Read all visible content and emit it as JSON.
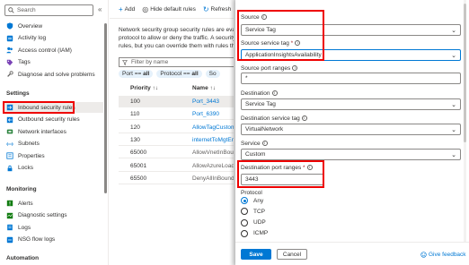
{
  "sidebar": {
    "search_placeholder": "Search",
    "collapse_glyph": "«",
    "items": [
      {
        "label": "Overview",
        "icon": "shield-icon",
        "color": "#0078d4"
      },
      {
        "label": "Activity log",
        "icon": "activity-log-icon",
        "color": "#0078d4"
      },
      {
        "label": "Access control (IAM)",
        "icon": "people-icon",
        "color": "#0078d4"
      },
      {
        "label": "Tags",
        "icon": "tag-icon",
        "color": "#7a43b6"
      },
      {
        "label": "Diagnose and solve problems",
        "icon": "wrench-icon",
        "color": "#605e5c"
      }
    ],
    "settings_header": "Settings",
    "settings_items": [
      {
        "label": "Inbound security rules",
        "icon": "inbound-icon",
        "color": "#0078d4"
      },
      {
        "label": "Outbound security rules",
        "icon": "outbound-icon",
        "color": "#0078d4"
      },
      {
        "label": "Network interfaces",
        "icon": "network-interface-icon",
        "color": "#2e8540"
      },
      {
        "label": "Subnets",
        "icon": "subnet-icon",
        "color": "#0078d4"
      },
      {
        "label": "Properties",
        "icon": "properties-icon",
        "color": "#0078d4"
      },
      {
        "label": "Locks",
        "icon": "lock-icon",
        "color": "#0078d4"
      }
    ],
    "monitoring_header": "Monitoring",
    "monitoring_items": [
      {
        "label": "Alerts",
        "icon": "alert-icon",
        "color": "#107c10"
      },
      {
        "label": "Diagnostic settings",
        "icon": "diagnostic-icon",
        "color": "#107c10"
      },
      {
        "label": "Logs",
        "icon": "logs-icon",
        "color": "#0078d4"
      },
      {
        "label": "NSG flow logs",
        "icon": "flow-logs-icon",
        "color": "#0078d4"
      }
    ],
    "automation_header": "Automation"
  },
  "toolbar": {
    "add": "Add",
    "hide_default": "Hide default rules",
    "refresh": "Refresh"
  },
  "main": {
    "desc_lines": [
      "Network security group security rules are evalua",
      "protocol to allow or deny the traffic. A security r",
      "rules, but you can override them with rules that l"
    ],
    "filter_placeholder": "Filter by name",
    "pills": [
      {
        "key": "Port == ",
        "val": "all"
      },
      {
        "key": "Protocol == ",
        "val": "all"
      },
      {
        "key": "So",
        "val": ""
      }
    ],
    "col_priority": "Priority ↑↓",
    "col_name": "Name ↑↓",
    "rows": [
      {
        "priority": "100",
        "name": "Port_3443",
        "link": true
      },
      {
        "priority": "110",
        "name": "Port_6390",
        "link": true
      },
      {
        "priority": "120",
        "name": "AllowTagCustom",
        "link": true
      },
      {
        "priority": "130",
        "name": "internetToMgtEn",
        "link": true
      },
      {
        "priority": "65000",
        "name": "AllowVnetInBoun",
        "link": false
      },
      {
        "priority": "65001",
        "name": "AllowAzureLoadB",
        "link": false
      },
      {
        "priority": "65500",
        "name": "DenyAllInBound",
        "link": false
      }
    ]
  },
  "panel": {
    "source_label": "Source",
    "source_value": "Service Tag",
    "source_tag_label": "Source service tag",
    "source_tag_value": "ApplicationInsightsAvailability",
    "source_ports_label": "Source port ranges",
    "source_ports_value": "*",
    "destination_label": "Destination",
    "destination_value": "Service Tag",
    "dest_tag_label": "Destination service tag",
    "dest_tag_value": "VirtualNetwork",
    "service_label": "Service",
    "service_value": "Custom",
    "dest_ports_label": "Destination port ranges",
    "dest_ports_value": "3443",
    "protocol_label": "Protocol",
    "protocols": [
      {
        "label": "Any",
        "selected": true
      },
      {
        "label": "TCP",
        "selected": false
      },
      {
        "label": "UDP",
        "selected": false
      },
      {
        "label": "ICMP",
        "selected": false
      }
    ],
    "save": "Save",
    "cancel": "Cancel",
    "feedback": "Give feedback",
    "required_mark": "*"
  },
  "colors": {
    "accent": "#0078d4",
    "highlight": "#e00000"
  }
}
